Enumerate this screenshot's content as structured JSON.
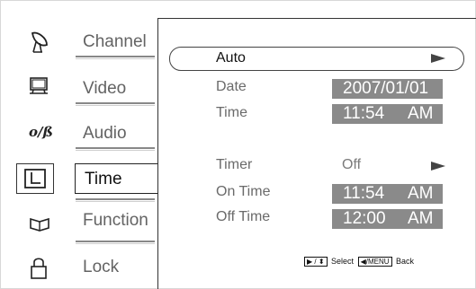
{
  "sidebar": {
    "items": [
      {
        "id": "channel",
        "label": "Channel",
        "icon": "satellite-dish-icon"
      },
      {
        "id": "video",
        "label": "Video",
        "icon": "monitor-icon"
      },
      {
        "id": "audio",
        "label": "Audio",
        "icon": "audio-logo-icon"
      },
      {
        "id": "time",
        "label": "Time",
        "icon": "clock-square-icon",
        "active": true
      },
      {
        "id": "function",
        "label": "Function",
        "icon": "open-book-icon"
      },
      {
        "id": "lock",
        "label": "Lock",
        "icon": "padlock-icon"
      }
    ]
  },
  "panel": {
    "auto": {
      "label": "Auto"
    },
    "date": {
      "label": "Date",
      "value": "2007/01/01"
    },
    "time": {
      "label": "Time",
      "value": "11:54",
      "ampm": "AM"
    },
    "timer": {
      "label": "Timer",
      "value": "Off"
    },
    "on_time": {
      "label": "On Time",
      "value": "11:54",
      "ampm": "AM"
    },
    "off_time": {
      "label": "Off Time",
      "value": "12:00",
      "ampm": "AM"
    }
  },
  "hint": {
    "key1": "▶ / ⬍",
    "select": "Select",
    "key2": "◀/MENU",
    "back": "Back"
  },
  "colors": {
    "value_box": "#8a8a8a",
    "text_dim": "#636363"
  }
}
